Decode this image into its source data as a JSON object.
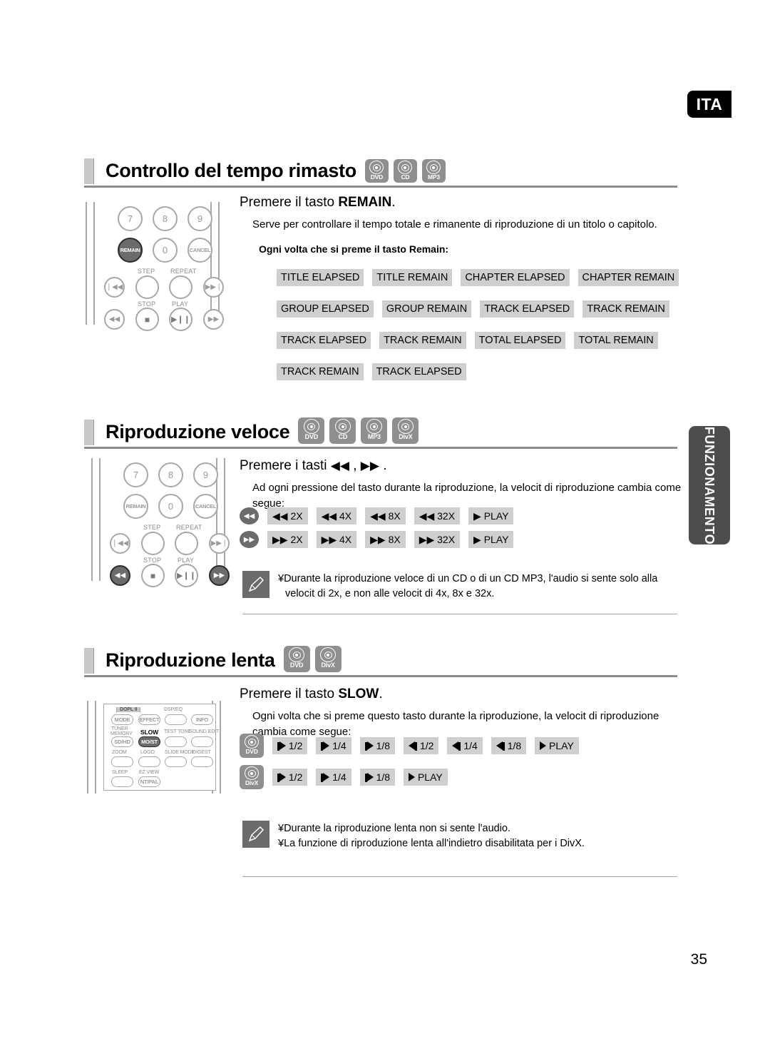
{
  "page": {
    "language_tab": "ITA",
    "side_tab": "FUNZIONAMENTO",
    "page_number": "35",
    "accent_gray": "#8f8f8f",
    "chip_gray": "#cfcfcf",
    "dark_gray": "#6b6b6b"
  },
  "sections": [
    {
      "id": "remaining-time",
      "title": "Controllo del tempo rimasto",
      "discs": [
        "DVD",
        "CD",
        "MP3"
      ],
      "lead_prefix": "Premere il tasto ",
      "lead_bold": "REMAIN",
      "lead_suffix": ".",
      "description": "Serve per controllare il tempo totale e rimanente di riproduzione di un titolo o capitolo.",
      "subhead": "Ogni volta che si preme il tasto Remain:",
      "rows": [
        [
          "TITLE ELAPSED",
          "TITLE REMAIN",
          "CHAPTER ELAPSED",
          "CHAPTER REMAIN"
        ],
        [
          "GROUP ELAPSED",
          "GROUP REMAIN",
          "TRACK ELAPSED",
          "TRACK REMAIN"
        ],
        [
          "TRACK ELAPSED",
          "TRACK REMAIN",
          "TOTAL ELAPSED",
          "TOTAL REMAIN"
        ],
        [
          "TRACK REMAIN",
          "TRACK ELAPSED"
        ]
      ]
    },
    {
      "id": "fast-playback",
      "title": "Riproduzione veloce",
      "discs": [
        "DVD",
        "CD",
        "MP3",
        "DivX"
      ],
      "lead_prefix": "Premere i tasti ",
      "lead_suffix": " .",
      "description": "Ad ogni pressione del tasto durante la riproduzione, la velocit  di riproduzione cambia come segue:",
      "speed_rows": [
        {
          "dir": "rew",
          "steps": [
            "2X",
            "4X",
            "8X",
            "32X"
          ],
          "end": "PLAY"
        },
        {
          "dir": "fwd",
          "steps": [
            "2X",
            "4X",
            "8X",
            "32X"
          ],
          "end": "PLAY"
        }
      ],
      "note_lines": [
        "¥Durante la riproduzione veloce di un CD o di un CD MP3, l'audio si sente solo alla",
        "velocit  di 2x, e non alle velocit  di 4x, 8x e 32x."
      ]
    },
    {
      "id": "slow-playback",
      "title": "Riproduzione lenta",
      "discs": [
        "DVD",
        "DivX"
      ],
      "lead_prefix": "Premere il tasto ",
      "lead_bold": "SLOW",
      "lead_suffix": ".",
      "description": "Ogni volta che si preme questo tasto durante la riproduzione, la velocit  di riproduzione cambia come segue:",
      "slow_rows": [
        {
          "disc": "DVD",
          "fwd": [
            "1/2",
            "1/4",
            "1/8"
          ],
          "rev": [
            "1/2",
            "1/4",
            "1/8"
          ],
          "end": "PLAY"
        },
        {
          "disc": "DivX",
          "fwd": [
            "1/2",
            "1/4",
            "1/8"
          ],
          "rev": [],
          "end": "PLAY"
        }
      ],
      "note_lines": [
        "¥Durante la riproduzione lenta non si sente l'audio.",
        "¥La funzione di riproduzione lenta all'indietro  disabilitata per i DivX."
      ]
    }
  ],
  "remote_numeric": {
    "keys_row1": [
      "7",
      "8",
      "9"
    ],
    "keys_row2": [
      "REMAIN",
      "0",
      "CANCEL"
    ],
    "labels": [
      "STEP",
      "REPEAT",
      "STOP",
      "PLAY"
    ]
  },
  "remote_panel": {
    "logo": "DOPL II",
    "buttons": [
      "MODE",
      "EFFECT",
      "INFO",
      "SD/HD",
      "MO/ST",
      "NT/PAL"
    ],
    "labels": [
      "DSP/EQ",
      "TUNER",
      "MEMORY",
      "SLOW",
      "TEST TONE",
      "SOUND EDIT",
      "ZOOM",
      "LOGO",
      "SLIDE MODE",
      "DIGEST",
      "SLEEP",
      "EZ VIEW"
    ]
  }
}
